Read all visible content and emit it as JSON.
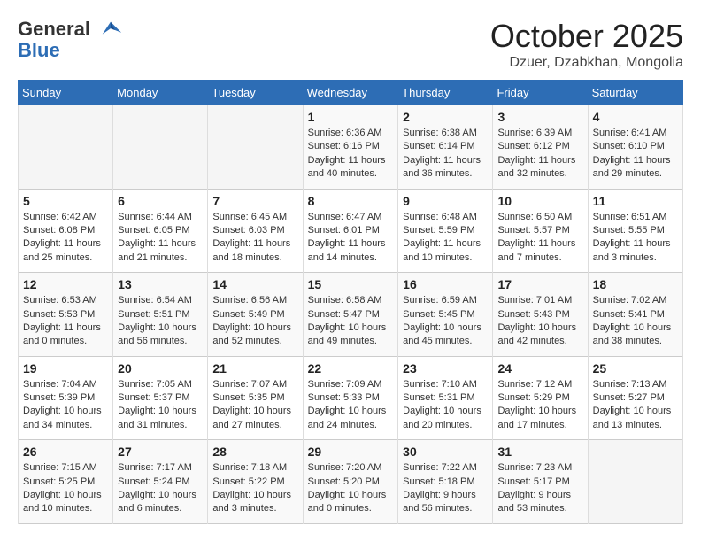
{
  "header": {
    "logo_line1": "General",
    "logo_line2": "Blue",
    "month": "October 2025",
    "location": "Dzuer, Dzabkhan, Mongolia"
  },
  "columns": [
    "Sunday",
    "Monday",
    "Tuesday",
    "Wednesday",
    "Thursday",
    "Friday",
    "Saturday"
  ],
  "weeks": [
    [
      {
        "day": "",
        "content": ""
      },
      {
        "day": "",
        "content": ""
      },
      {
        "day": "",
        "content": ""
      },
      {
        "day": "1",
        "content": "Sunrise: 6:36 AM\nSunset: 6:16 PM\nDaylight: 11 hours and 40 minutes."
      },
      {
        "day": "2",
        "content": "Sunrise: 6:38 AM\nSunset: 6:14 PM\nDaylight: 11 hours and 36 minutes."
      },
      {
        "day": "3",
        "content": "Sunrise: 6:39 AM\nSunset: 6:12 PM\nDaylight: 11 hours and 32 minutes."
      },
      {
        "day": "4",
        "content": "Sunrise: 6:41 AM\nSunset: 6:10 PM\nDaylight: 11 hours and 29 minutes."
      }
    ],
    [
      {
        "day": "5",
        "content": "Sunrise: 6:42 AM\nSunset: 6:08 PM\nDaylight: 11 hours and 25 minutes."
      },
      {
        "day": "6",
        "content": "Sunrise: 6:44 AM\nSunset: 6:05 PM\nDaylight: 11 hours and 21 minutes."
      },
      {
        "day": "7",
        "content": "Sunrise: 6:45 AM\nSunset: 6:03 PM\nDaylight: 11 hours and 18 minutes."
      },
      {
        "day": "8",
        "content": "Sunrise: 6:47 AM\nSunset: 6:01 PM\nDaylight: 11 hours and 14 minutes."
      },
      {
        "day": "9",
        "content": "Sunrise: 6:48 AM\nSunset: 5:59 PM\nDaylight: 11 hours and 10 minutes."
      },
      {
        "day": "10",
        "content": "Sunrise: 6:50 AM\nSunset: 5:57 PM\nDaylight: 11 hours and 7 minutes."
      },
      {
        "day": "11",
        "content": "Sunrise: 6:51 AM\nSunset: 5:55 PM\nDaylight: 11 hours and 3 minutes."
      }
    ],
    [
      {
        "day": "12",
        "content": "Sunrise: 6:53 AM\nSunset: 5:53 PM\nDaylight: 11 hours and 0 minutes."
      },
      {
        "day": "13",
        "content": "Sunrise: 6:54 AM\nSunset: 5:51 PM\nDaylight: 10 hours and 56 minutes."
      },
      {
        "day": "14",
        "content": "Sunrise: 6:56 AM\nSunset: 5:49 PM\nDaylight: 10 hours and 52 minutes."
      },
      {
        "day": "15",
        "content": "Sunrise: 6:58 AM\nSunset: 5:47 PM\nDaylight: 10 hours and 49 minutes."
      },
      {
        "day": "16",
        "content": "Sunrise: 6:59 AM\nSunset: 5:45 PM\nDaylight: 10 hours and 45 minutes."
      },
      {
        "day": "17",
        "content": "Sunrise: 7:01 AM\nSunset: 5:43 PM\nDaylight: 10 hours and 42 minutes."
      },
      {
        "day": "18",
        "content": "Sunrise: 7:02 AM\nSunset: 5:41 PM\nDaylight: 10 hours and 38 minutes."
      }
    ],
    [
      {
        "day": "19",
        "content": "Sunrise: 7:04 AM\nSunset: 5:39 PM\nDaylight: 10 hours and 34 minutes."
      },
      {
        "day": "20",
        "content": "Sunrise: 7:05 AM\nSunset: 5:37 PM\nDaylight: 10 hours and 31 minutes."
      },
      {
        "day": "21",
        "content": "Sunrise: 7:07 AM\nSunset: 5:35 PM\nDaylight: 10 hours and 27 minutes."
      },
      {
        "day": "22",
        "content": "Sunrise: 7:09 AM\nSunset: 5:33 PM\nDaylight: 10 hours and 24 minutes."
      },
      {
        "day": "23",
        "content": "Sunrise: 7:10 AM\nSunset: 5:31 PM\nDaylight: 10 hours and 20 minutes."
      },
      {
        "day": "24",
        "content": "Sunrise: 7:12 AM\nSunset: 5:29 PM\nDaylight: 10 hours and 17 minutes."
      },
      {
        "day": "25",
        "content": "Sunrise: 7:13 AM\nSunset: 5:27 PM\nDaylight: 10 hours and 13 minutes."
      }
    ],
    [
      {
        "day": "26",
        "content": "Sunrise: 7:15 AM\nSunset: 5:25 PM\nDaylight: 10 hours and 10 minutes."
      },
      {
        "day": "27",
        "content": "Sunrise: 7:17 AM\nSunset: 5:24 PM\nDaylight: 10 hours and 6 minutes."
      },
      {
        "day": "28",
        "content": "Sunrise: 7:18 AM\nSunset: 5:22 PM\nDaylight: 10 hours and 3 minutes."
      },
      {
        "day": "29",
        "content": "Sunrise: 7:20 AM\nSunset: 5:20 PM\nDaylight: 10 hours and 0 minutes."
      },
      {
        "day": "30",
        "content": "Sunrise: 7:22 AM\nSunset: 5:18 PM\nDaylight: 9 hours and 56 minutes."
      },
      {
        "day": "31",
        "content": "Sunrise: 7:23 AM\nSunset: 5:17 PM\nDaylight: 9 hours and 53 minutes."
      },
      {
        "day": "",
        "content": ""
      }
    ]
  ]
}
